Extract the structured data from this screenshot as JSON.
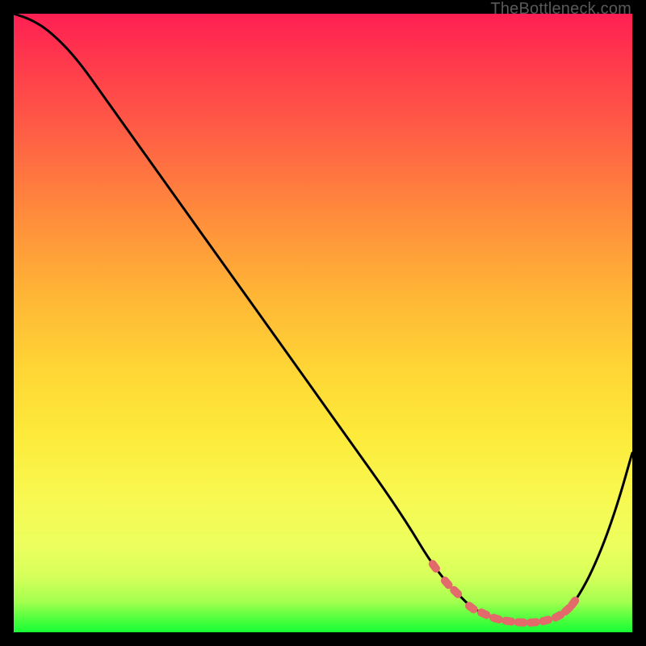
{
  "watermark": "TheBottleneck.com",
  "colors": {
    "curve_stroke": "#000000",
    "marker_fill": "#e26a6a",
    "background_black": "#000000"
  },
  "chart_data": {
    "type": "line",
    "title": "",
    "xlabel": "",
    "ylabel": "",
    "xlim": [
      0,
      100
    ],
    "ylim": [
      0,
      100
    ],
    "grid": false,
    "legend": false,
    "series": [
      {
        "name": "bottleneck-curve",
        "x": [
          0,
          3,
          6,
          10,
          15,
          20,
          25,
          30,
          35,
          40,
          45,
          50,
          55,
          60,
          64,
          67,
          70,
          72,
          74,
          76,
          78,
          80,
          82,
          84,
          86,
          88,
          90,
          92,
          94,
          96,
          98,
          100
        ],
        "y": [
          100,
          99,
          97,
          93,
          86,
          79,
          72,
          65,
          58,
          51,
          44,
          37,
          30,
          23,
          17,
          12,
          8,
          6,
          4,
          3,
          2.2,
          1.8,
          1.6,
          1.6,
          1.9,
          2.6,
          4,
          7,
          11,
          16,
          22,
          29
        ]
      }
    ],
    "markers": {
      "series": "bottleneck-curve",
      "points_x": [
        68,
        70,
        71.5,
        74,
        76,
        78,
        80,
        82,
        84,
        86,
        88,
        89.5,
        90.5
      ],
      "shape": "capsule",
      "note": "salmon pill markers clustered along the flat minimum of the curve"
    },
    "background_gradient": {
      "orientation": "vertical",
      "stops": [
        {
          "pos": 0.0,
          "color": "#ff1f53"
        },
        {
          "pos": 0.32,
          "color": "#ff8a3c"
        },
        {
          "pos": 0.58,
          "color": "#ffd735"
        },
        {
          "pos": 0.86,
          "color": "#ecff5e"
        },
        {
          "pos": 1.0,
          "color": "#17ff34"
        }
      ]
    }
  }
}
